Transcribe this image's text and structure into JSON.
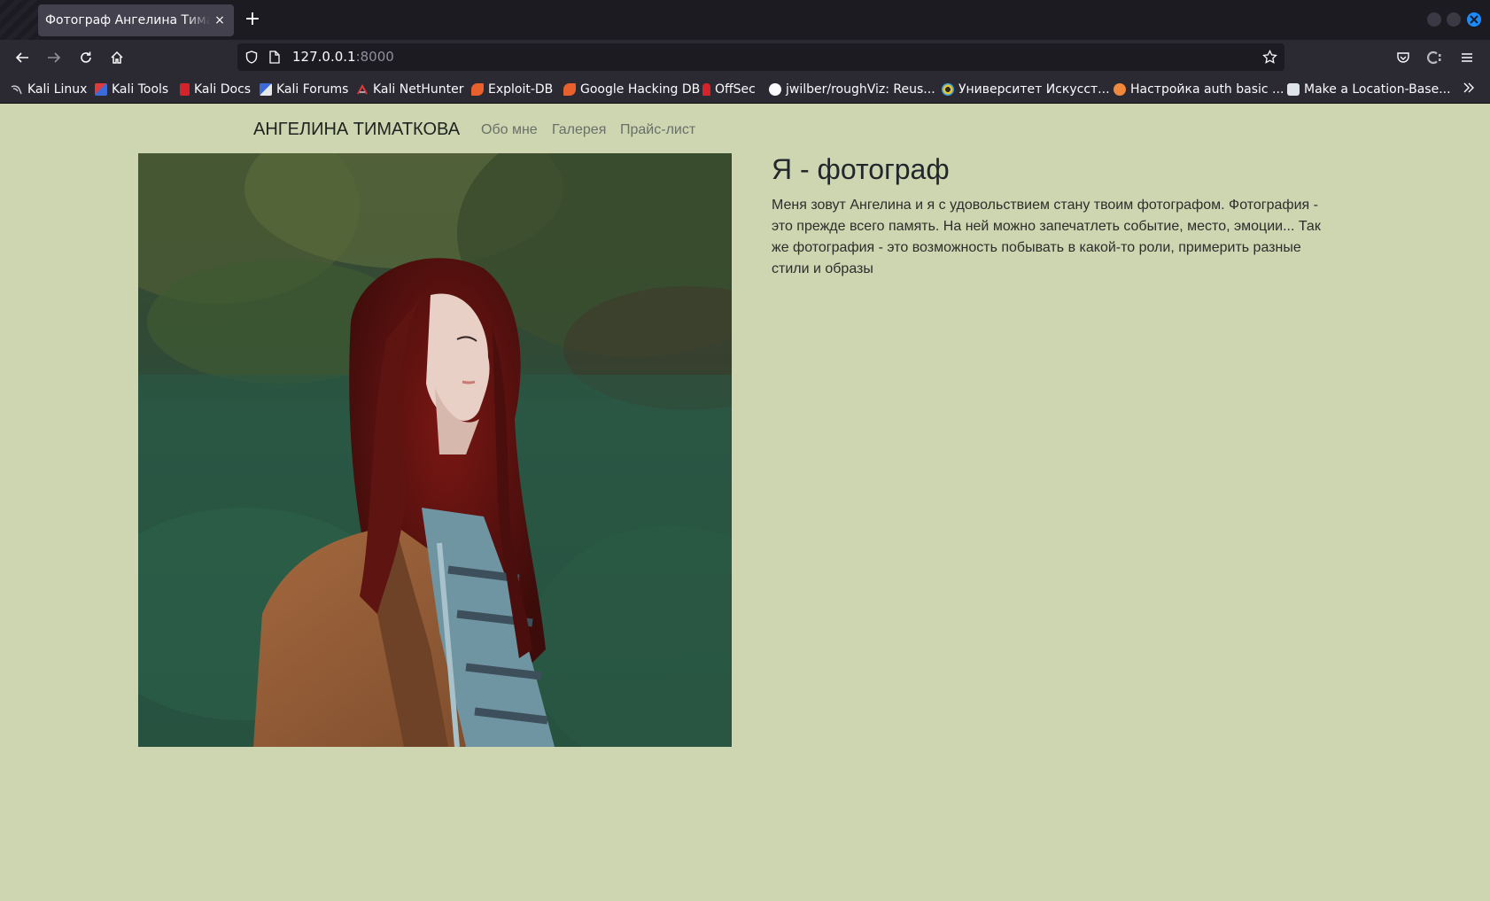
{
  "browser": {
    "tab_title": "Фотограф Ангелина Тиматкова",
    "tab_close_icon": "×",
    "new_tab_icon": "+",
    "url_host": "127.0.0.1",
    "url_port": ":8000",
    "colors": {
      "frame": "#1c1b22",
      "toolbar": "#2b2a33",
      "tab": "#42414d",
      "accent": "#1a8cff"
    }
  },
  "bookmarks": [
    {
      "label": "Kali Linux",
      "icon": "kali-dragon-icon"
    },
    {
      "label": "Kali Tools",
      "icon": "kali-tools-icon"
    },
    {
      "label": "Kali Docs",
      "icon": "kali-docs-icon"
    },
    {
      "label": "Kali Forums",
      "icon": "kali-forums-icon"
    },
    {
      "label": "Kali NetHunter",
      "icon": "nethunter-icon"
    },
    {
      "label": "Exploit-DB",
      "icon": "exploit-db-icon"
    },
    {
      "label": "Google Hacking DB",
      "icon": "ghdb-icon"
    },
    {
      "label": "OffSec",
      "icon": "offsec-icon"
    },
    {
      "label": "jwilber/roughViz: Reus...",
      "icon": "github-icon"
    },
    {
      "label": "Университет Искусст...",
      "icon": "university-icon"
    },
    {
      "label": "Настройка auth basic ...",
      "icon": "itc-icon"
    },
    {
      "label": "Make a Location-Base...",
      "icon": "puzzle-icon"
    }
  ],
  "site": {
    "brand": "АНГЕЛИНА ТИМАТКОВА",
    "nav": [
      "Обо мне",
      "Галерея",
      "Прайс-лист"
    ],
    "about_title": "Я - фотограф",
    "about_text": "Меня зовут Ангелина и я с удовольствием стану твоим фотографом. Фотография - это прежде всего память. На ней можно запечатлеть событие, место, эмоции... Так же фотография - это возможность побывать в какой-то роли, примерить разные стили и образы",
    "colors": {
      "background": "#cdd5b1",
      "text": "#23272b",
      "nav_link": "#6a6f69"
    }
  }
}
